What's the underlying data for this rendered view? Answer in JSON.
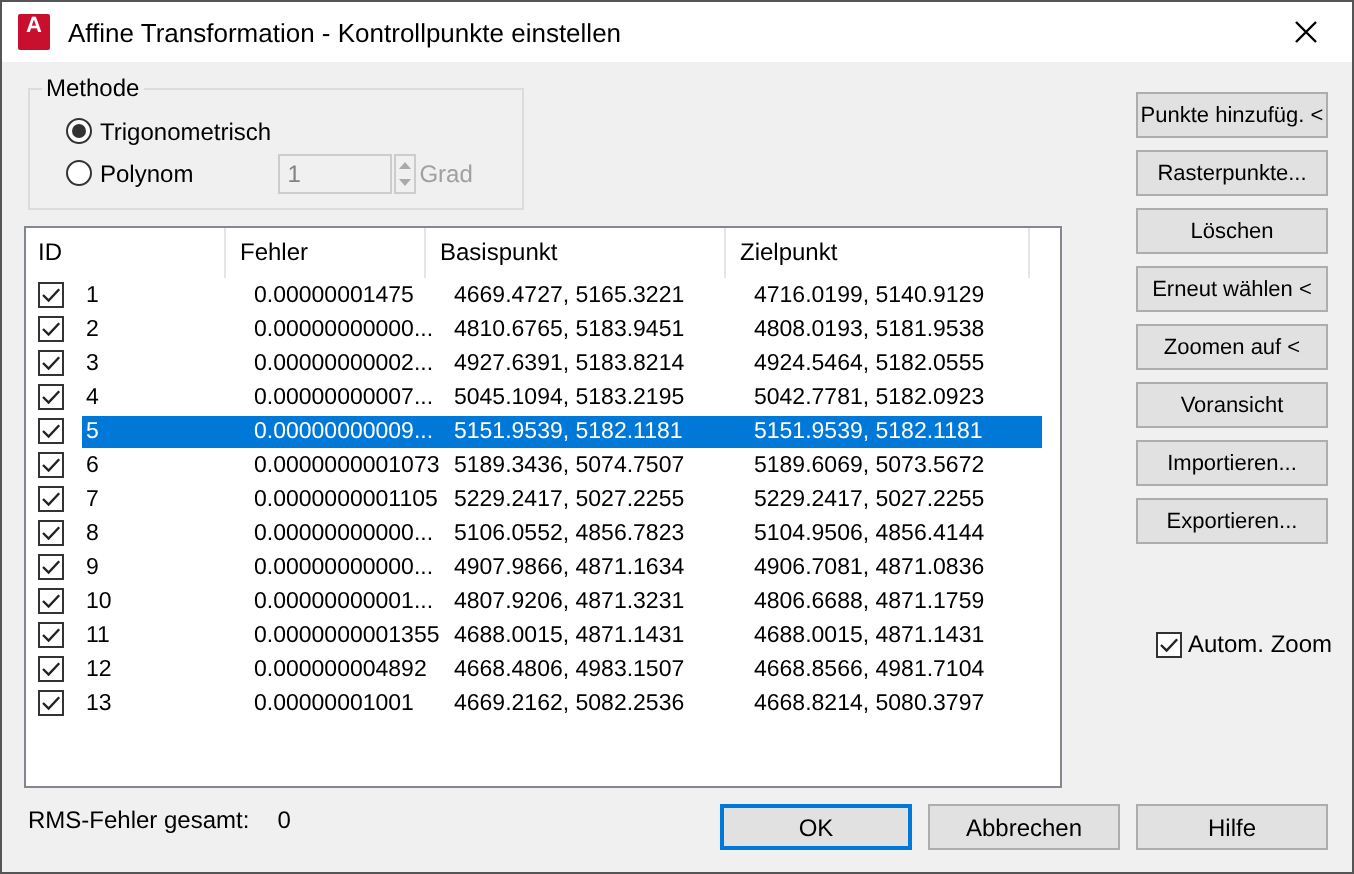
{
  "window": {
    "title": "Affine Transformation - Kontrollpunkte einstellen",
    "app_icon_letter": "A"
  },
  "method": {
    "title": "Methode",
    "options": [
      {
        "label": "Trigonometrisch",
        "selected": true
      },
      {
        "label": "Polynom",
        "selected": false
      }
    ],
    "degree": {
      "value": "1",
      "unit": "Grad",
      "disabled": true
    }
  },
  "table": {
    "columns": [
      "ID",
      "Fehler",
      "Basispunkt",
      "Zielpunkt"
    ],
    "rows": [
      {
        "checked": true,
        "selected": false,
        "cells": [
          "1",
          "0.00000001475",
          "4669.4727, 5165.3221",
          "4716.0199, 5140.9129"
        ]
      },
      {
        "checked": true,
        "selected": false,
        "cells": [
          "2",
          "0.00000000000...",
          "4810.6765, 5183.9451",
          "4808.0193, 5181.9538"
        ]
      },
      {
        "checked": true,
        "selected": false,
        "cells": [
          "3",
          "0.00000000002...",
          "4927.6391, 5183.8214",
          "4924.5464, 5182.0555"
        ]
      },
      {
        "checked": true,
        "selected": false,
        "cells": [
          "4",
          "0.00000000007...",
          "5045.1094, 5183.2195",
          "5042.7781, 5182.0923"
        ]
      },
      {
        "checked": true,
        "selected": true,
        "cells": [
          "5",
          "0.00000000009...",
          "5151.9539, 5182.1181",
          "5151.9539, 5182.1181"
        ]
      },
      {
        "checked": true,
        "selected": false,
        "cells": [
          "6",
          "0.0000000001073",
          "5189.3436, 5074.7507",
          "5189.6069, 5073.5672"
        ]
      },
      {
        "checked": true,
        "selected": false,
        "cells": [
          "7",
          "0.0000000001105",
          "5229.2417, 5027.2255",
          "5229.2417, 5027.2255"
        ]
      },
      {
        "checked": true,
        "selected": false,
        "cells": [
          "8",
          "0.00000000000...",
          "5106.0552, 4856.7823",
          "5104.9506, 4856.4144"
        ]
      },
      {
        "checked": true,
        "selected": false,
        "cells": [
          "9",
          "0.00000000000...",
          "4907.9866, 4871.1634",
          "4906.7081, 4871.0836"
        ]
      },
      {
        "checked": true,
        "selected": false,
        "cells": [
          "10",
          "0.00000000001...",
          "4807.9206, 4871.3231",
          "4806.6688, 4871.1759"
        ]
      },
      {
        "checked": true,
        "selected": false,
        "cells": [
          "11",
          "0.0000000001355",
          "4688.0015, 4871.1431",
          "4688.0015, 4871.1431"
        ]
      },
      {
        "checked": true,
        "selected": false,
        "cells": [
          "12",
          "0.000000004892",
          "4668.4806, 4983.1507",
          "4668.8566, 4981.7104"
        ]
      },
      {
        "checked": true,
        "selected": false,
        "cells": [
          "13",
          "0.00000001001",
          "4669.2162, 5082.2536",
          "4668.8214, 5080.3797"
        ]
      }
    ]
  },
  "side_buttons": [
    "Punkte hinzufüg. <",
    "Rasterpunkte...",
    "Löschen",
    "Erneut wählen <",
    "Zoomen auf <",
    "Voransicht",
    "Importieren...",
    "Exportieren..."
  ],
  "auto_zoom": {
    "label": "Autom. Zoom",
    "checked": true
  },
  "footer": {
    "rms_label": "RMS-Fehler gesamt:",
    "rms_value": "0",
    "buttons": [
      {
        "label": "OK",
        "default": true
      },
      {
        "label": "Abbrechen",
        "default": false
      },
      {
        "label": "Hilfe",
        "default": false
      }
    ]
  }
}
